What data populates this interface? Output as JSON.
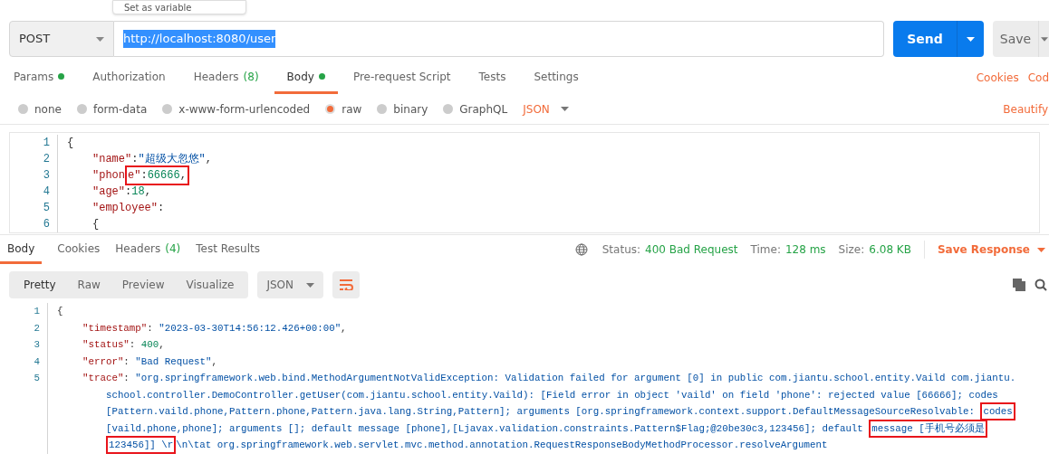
{
  "popup": {
    "label": "Set as variable"
  },
  "request": {
    "method": "POST",
    "url": "http://localhost:8080/user",
    "url_selected": true,
    "send": "Send",
    "save": "Save"
  },
  "request_tabs": [
    {
      "label": "Params",
      "dot": true,
      "selected": false
    },
    {
      "label": "Authorization",
      "dot": false,
      "selected": false
    },
    {
      "label": "Headers",
      "count": "(8)",
      "dot": false,
      "selected": false
    },
    {
      "label": "Body",
      "dot": true,
      "selected": true
    },
    {
      "label": "Pre-request Script",
      "dot": false,
      "selected": false
    },
    {
      "label": "Tests",
      "dot": false,
      "selected": false
    },
    {
      "label": "Settings",
      "dot": false,
      "selected": false
    }
  ],
  "request_links": [
    "Cookies",
    "Cod"
  ],
  "body_types": [
    {
      "label": "none",
      "selected": false
    },
    {
      "label": "form-data",
      "selected": false
    },
    {
      "label": "x-www-form-urlencoded",
      "selected": false
    },
    {
      "label": "raw",
      "selected": true
    },
    {
      "label": "binary",
      "selected": false
    },
    {
      "label": "GraphQL",
      "selected": false
    }
  ],
  "body_format": "JSON",
  "beautify": "Beautify",
  "request_body": [
    {
      "num": "1",
      "kind": "root",
      "segments": [
        {
          "boxed": false,
          "tokens": [
            {
              "kind": "punct",
              "text": "{"
            }
          ]
        }
      ]
    },
    {
      "num": "2",
      "kind": "member",
      "segments": [
        {
          "boxed": false,
          "tokens": [
            {
              "kind": "key",
              "text": "\"name\""
            },
            {
              "kind": "punct",
              "text": ":"
            },
            {
              "kind": "string",
              "text": "\"超级大忽悠\""
            },
            {
              "kind": "punct",
              "text": ","
            }
          ]
        }
      ]
    },
    {
      "num": "3",
      "kind": "member",
      "segments": [
        {
          "boxed": false,
          "tokens": [
            {
              "kind": "key",
              "text": "\"phon"
            }
          ]
        },
        {
          "boxed": true,
          "tokens": [
            {
              "kind": "key",
              "text": "e\""
            },
            {
              "kind": "punct",
              "text": ":"
            },
            {
              "kind": "number",
              "text": "66666"
            },
            {
              "kind": "punct",
              "text": ","
            }
          ]
        }
      ]
    },
    {
      "num": "4",
      "kind": "member",
      "segments": [
        {
          "boxed": false,
          "tokens": [
            {
              "kind": "key",
              "text": "\"age\""
            },
            {
              "kind": "punct",
              "text": ":"
            },
            {
              "kind": "number",
              "text": "18"
            },
            {
              "kind": "punct",
              "text": ","
            }
          ]
        }
      ]
    },
    {
      "num": "5",
      "kind": "member",
      "segments": [
        {
          "boxed": false,
          "tokens": [
            {
              "kind": "key",
              "text": "\"employee\""
            },
            {
              "kind": "punct",
              "text": ":"
            }
          ]
        }
      ]
    },
    {
      "num": "6",
      "kind": "member",
      "segments": [
        {
          "boxed": false,
          "tokens": [
            {
              "kind": "punct",
              "text": "{"
            }
          ]
        }
      ]
    }
  ],
  "response_tabs": [
    {
      "label": "Body",
      "selected": true
    },
    {
      "label": "Cookies",
      "selected": false
    },
    {
      "label": "Headers",
      "count": "(4)",
      "selected": false
    },
    {
      "label": "Test Results",
      "selected": false
    }
  ],
  "response_meta": [
    {
      "label": "Status:",
      "value": "400 Bad Request"
    },
    {
      "label": "Time:",
      "value": "128 ms"
    },
    {
      "label": "Size:",
      "value": "6.08 KB"
    }
  ],
  "save_response": "Save Response",
  "view_modes": [
    {
      "label": "Pretty",
      "selected": true
    },
    {
      "label": "Raw",
      "selected": false
    },
    {
      "label": "Preview",
      "selected": false
    },
    {
      "label": "Visualize",
      "selected": false
    }
  ],
  "response_format": "JSON",
  "wrap_on": true,
  "response_body": [
    {
      "num": "1",
      "kind": "root",
      "segments": [
        {
          "boxed": false,
          "tokens": [
            {
              "kind": "punct",
              "text": "{"
            }
          ]
        }
      ]
    },
    {
      "num": "2",
      "kind": "member",
      "segments": [
        {
          "boxed": false,
          "tokens": [
            {
              "kind": "key",
              "text": "\"timestamp\""
            },
            {
              "kind": "punct",
              "text": ": "
            },
            {
              "kind": "string",
              "text": "\"2023-03-30T14:56:12.426+00:00\""
            },
            {
              "kind": "punct",
              "text": ","
            }
          ]
        }
      ]
    },
    {
      "num": "3",
      "kind": "member",
      "segments": [
        {
          "boxed": false,
          "tokens": [
            {
              "kind": "key",
              "text": "\"status\""
            },
            {
              "kind": "punct",
              "text": ": "
            },
            {
              "kind": "number",
              "text": "400"
            },
            {
              "kind": "punct",
              "text": ","
            }
          ]
        }
      ]
    },
    {
      "num": "4",
      "kind": "member",
      "segments": [
        {
          "boxed": false,
          "tokens": [
            {
              "kind": "key",
              "text": "\"error\""
            },
            {
              "kind": "punct",
              "text": ": "
            },
            {
              "kind": "string",
              "text": "\"Bad Request\""
            },
            {
              "kind": "punct",
              "text": ","
            }
          ]
        }
      ]
    },
    {
      "num": "5",
      "kind": "member",
      "segments": [
        {
          "boxed": false,
          "tokens": [
            {
              "kind": "key",
              "text": "\"trace\""
            },
            {
              "kind": "punct",
              "text": ": "
            },
            {
              "kind": "string",
              "text": "\"org.springframework.web.bind.MethodArgumentNotValidException: Validation failed for argument [0] in public com.jiantu.school.entity.Vaild com.jiantu."
            }
          ]
        }
      ]
    },
    {
      "kind": "wrapped",
      "segments": [
        {
          "boxed": false,
          "tokens": [
            {
              "kind": "string",
              "text": "school.controller.DemoController.getUser(com.jiantu.school.entity.Vaild): [Field error in object 'vaild' on field 'phone': rejected value [66666]; codes"
            }
          ]
        }
      ]
    },
    {
      "kind": "wrapped",
      "segments": [
        {
          "boxed": false,
          "tokens": [
            {
              "kind": "string",
              "text": "[Pattern.vaild.phone,Pattern.phone,Pattern.java.lang.String,Pattern]; arguments [org.springframework.context.support.DefaultMessageSourceResolvable: "
            }
          ]
        },
        {
          "boxed": true,
          "tokens": [
            {
              "kind": "string",
              "text": "codes"
            }
          ]
        }
      ]
    },
    {
      "kind": "wrapped",
      "segments": [
        {
          "boxed": false,
          "tokens": [
            {
              "kind": "string",
              "text": "[vaild.phone,phone]; arguments []; default message [phone],[Ljavax.validation.constraints.Pattern$Flag;@20be30c3,123456]; default "
            }
          ]
        },
        {
          "boxed": true,
          "tokens": [
            {
              "kind": "string",
              "text": "message [手机号必须是"
            }
          ]
        }
      ]
    },
    {
      "kind": "wrapped",
      "segments": [
        {
          "boxed": true,
          "tokens": [
            {
              "kind": "string",
              "text": "123456]] \\r"
            }
          ]
        },
        {
          "boxed": false,
          "tokens": [
            {
              "kind": "string",
              "text": "\\n\\tat org.springframework.web.servlet.mvc.method.annotation.RequestResponseBodyMethodProcessor.resolveArgument"
            }
          ]
        }
      ]
    }
  ]
}
